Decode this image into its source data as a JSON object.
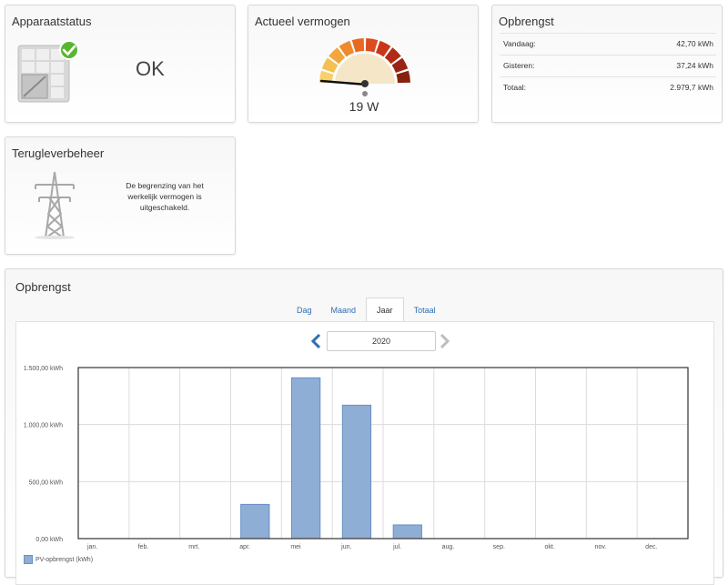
{
  "device_status": {
    "title": "Apparaatstatus",
    "status": "OK"
  },
  "current_power": {
    "title": "Actueel vermogen",
    "value": "19 W"
  },
  "yield_card": {
    "title": "Opbrengst",
    "rows": [
      {
        "label": "Vandaag:",
        "value": "42,70 kWh"
      },
      {
        "label": "Gisteren:",
        "value": "37,24 kWh"
      },
      {
        "label": "Totaal:",
        "value": "2.979,7 kWh"
      }
    ]
  },
  "feed_in": {
    "title": "Terugleverbeheer",
    "message": "De begrenzing van het werkelijk vermogen is uitgeschakeld."
  },
  "yield_chart": {
    "title": "Opbrengst",
    "tabs": [
      "Dag",
      "Maand",
      "Jaar",
      "Totaal"
    ],
    "active_tab": "Jaar",
    "year": "2020",
    "legend": "PV-opbrengst (kWh)"
  },
  "chart_data": {
    "type": "bar",
    "categories": [
      "jan.",
      "feb.",
      "mrt.",
      "apr.",
      "mei",
      "jun.",
      "jul.",
      "aug.",
      "sep.",
      "okt.",
      "nov.",
      "dec."
    ],
    "series": [
      {
        "name": "PV-opbrengst (kWh)",
        "values": [
          0,
          0,
          0,
          300,
          1410,
          1170,
          120,
          0,
          0,
          0,
          0,
          0
        ]
      }
    ],
    "ylim": [
      0,
      1500
    ],
    "yticks": [
      0,
      500,
      1000,
      1500
    ],
    "ytick_labels": [
      "0,00 kWh",
      "500,00 kWh",
      "1.000,00 kWh",
      "1.500,00 kWh"
    ],
    "grid": true,
    "legend_position": "bottom-left",
    "bar_color": "#8eaed6",
    "bar_border": "#6a8fc4"
  }
}
